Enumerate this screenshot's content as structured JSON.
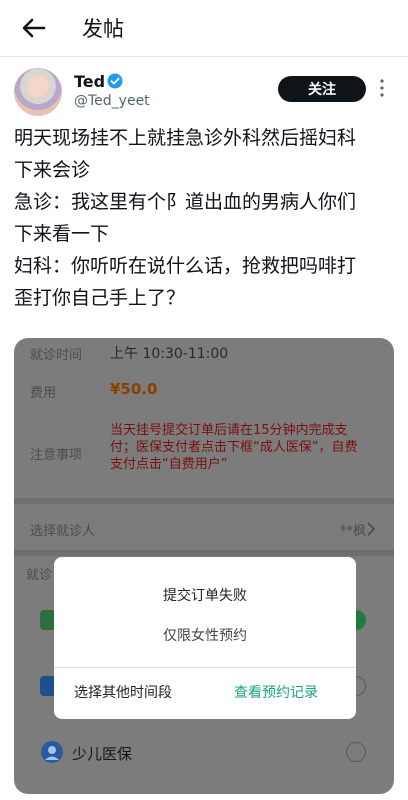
{
  "topbar": {
    "title": "发帖"
  },
  "author": {
    "name": "Ted",
    "handle": "@Ted_yeet",
    "follow_label": "关注"
  },
  "tweet": {
    "lines": [
      "明天现场挂不上就挂急诊外科然后摇妇科",
      "下来会诊",
      "急诊：我这里有个阝道出血的男病人你们",
      "下来看一下",
      "妇科：你听听在说什么话，抢救把吗啡打",
      "歪打你自己手上了？"
    ]
  },
  "screenshot": {
    "time_label": "就诊时间",
    "time_value": "上午 10:30-11:00",
    "fee_label": "费用",
    "fee_value": "¥50.0",
    "note_label": "注意事项",
    "note_text": "当天挂号提交订单后请在15分钟内完成支付；医保支付者点击下框“成人医保”，自费支付点击“自费用户”",
    "patient_label": "选择就诊人",
    "patient_value": "**枫",
    "pay_section_label": "就诊",
    "child_insurance_label": "少儿医保",
    "dialog": {
      "title": "提交订单失败",
      "message": "仅限女性预约",
      "btn_other": "选择其他时间段",
      "btn_records": "查看预约记录"
    }
  }
}
